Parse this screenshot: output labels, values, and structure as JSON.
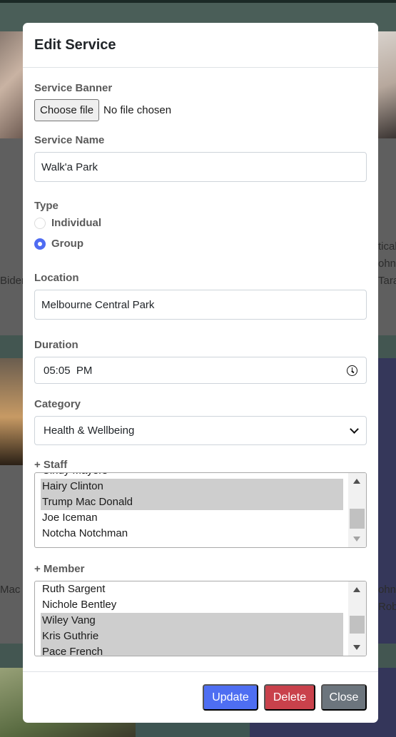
{
  "background": {
    "left_texts": [
      "Bider",
      "Mac D"
    ],
    "right_texts": [
      "tical",
      "ohn",
      "Tara",
      "ohn",
      "Rob"
    ]
  },
  "modal": {
    "title": "Edit Service",
    "banner": {
      "label": "Service Banner",
      "button": "Choose file",
      "status": "No file chosen"
    },
    "service_name": {
      "label": "Service Name",
      "value": "Walk'a Park"
    },
    "type": {
      "label": "Type",
      "options": [
        {
          "label": "Individual",
          "checked": false
        },
        {
          "label": "Group",
          "checked": true
        }
      ]
    },
    "location": {
      "label": "Location",
      "value": "Melbourne Central Park"
    },
    "duration": {
      "label": "Duration",
      "value": "05:05  PM"
    },
    "category": {
      "label": "Category",
      "value": "Health & Wellbeing"
    },
    "staff": {
      "label": "+ Staff",
      "items": [
        {
          "name": "Cindy Mayers",
          "selected": false
        },
        {
          "name": "Hairy Clinton",
          "selected": true
        },
        {
          "name": "Trump Mac Donald",
          "selected": true
        },
        {
          "name": "Joe Iceman",
          "selected": false
        },
        {
          "name": "Notcha Notchman",
          "selected": false
        }
      ]
    },
    "member": {
      "label": "+ Member",
      "items": [
        {
          "name": "Ruth Sargent",
          "selected": false
        },
        {
          "name": "Nichole Bentley",
          "selected": false
        },
        {
          "name": "Wiley Vang",
          "selected": true
        },
        {
          "name": "Kris Guthrie",
          "selected": true
        },
        {
          "name": "Pace French",
          "selected": true
        }
      ]
    },
    "footer": {
      "update": "Update",
      "delete": "Delete",
      "close": "Close"
    }
  },
  "colors": {
    "primary": "#4e6ef2",
    "danger": "#c9414b",
    "secondary": "#6c757d",
    "selected_row": "#cecece"
  }
}
